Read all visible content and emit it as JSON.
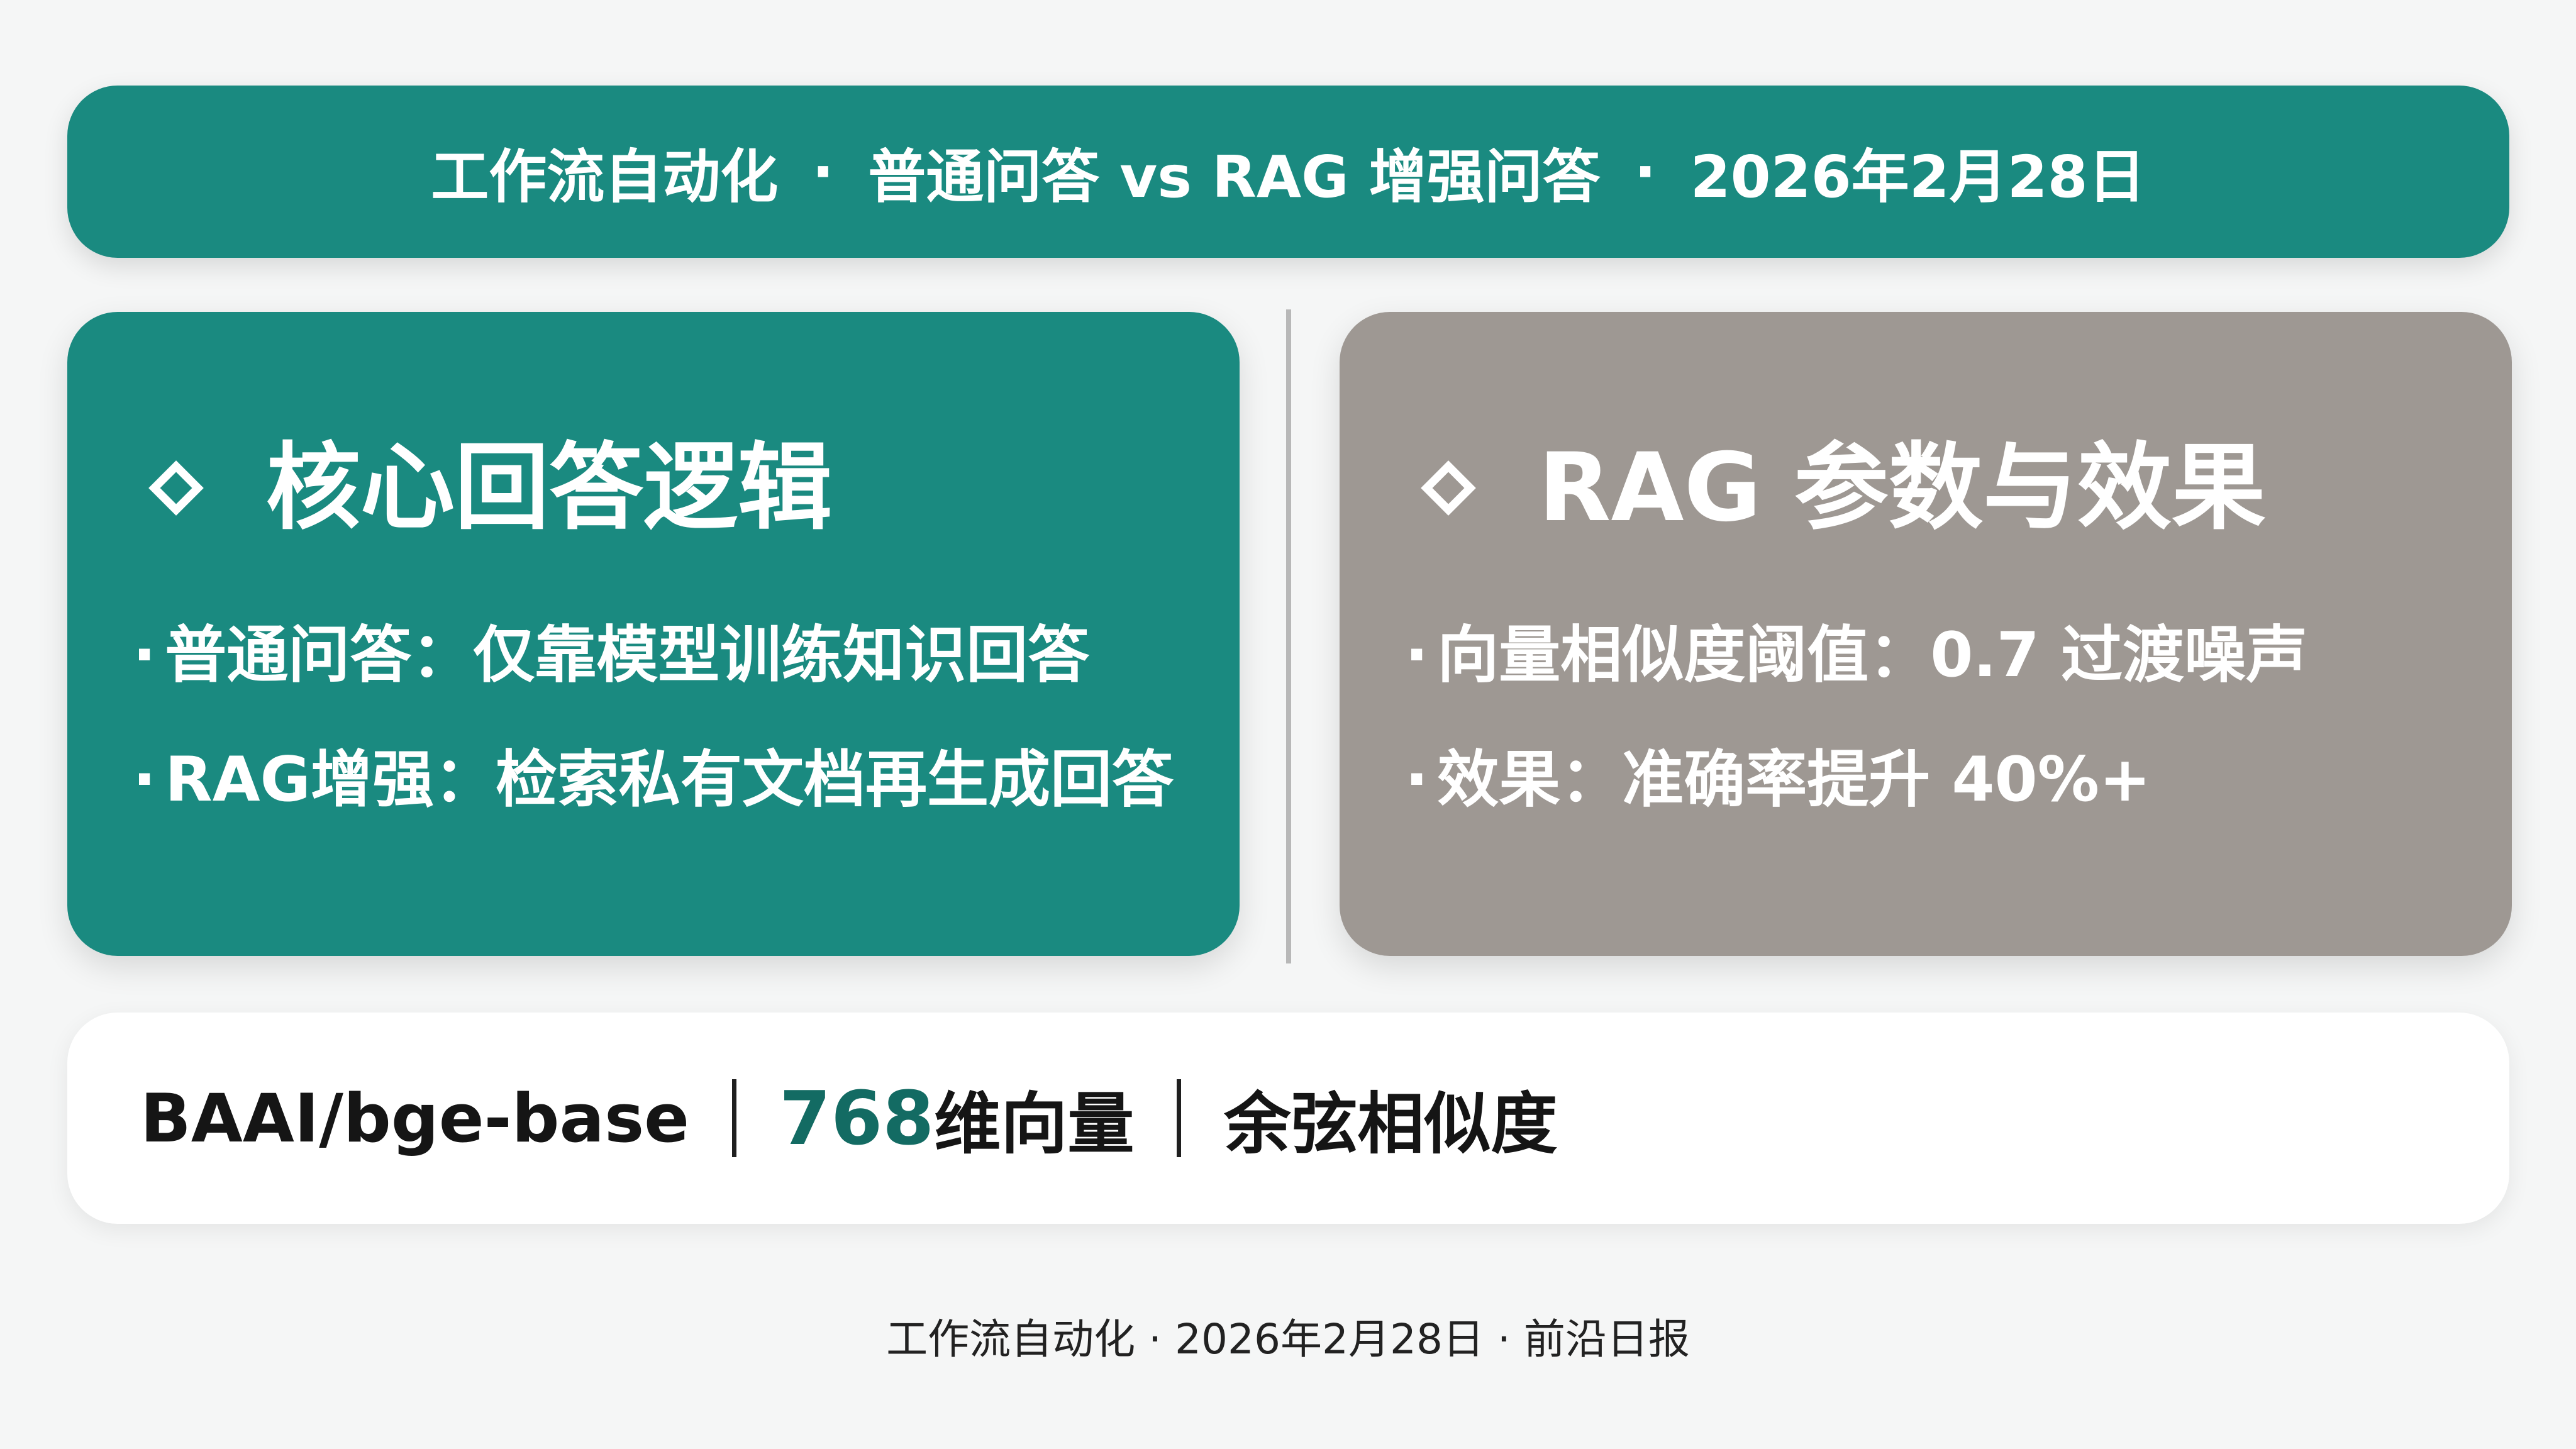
{
  "header": {
    "part1": "工作流自动化",
    "sep": "·",
    "part2": "普通问答 vs RAG 增强问答",
    "part3": "2026年2月28日"
  },
  "cards": {
    "left": {
      "title": "核心回答逻辑",
      "bullets": [
        "普通问答：仅靠模型训练知识回答",
        "RAG增强：检索私有文档再生成回答"
      ]
    },
    "right": {
      "title": "RAG 参数与效果",
      "bullets": [
        "向量相似度阈值：0.7 过渡噪声",
        "效果：准确率提升 40%+"
      ]
    },
    "bullet_dot": "·"
  },
  "specs": {
    "model": "BAAI/bge-base",
    "dim_number": "768",
    "dim_label": "维向量",
    "metric": "余弦相似度"
  },
  "footer": {
    "text": "工作流自动化 · 2026年2月28日 · 前沿日报"
  },
  "colors": {
    "teal": "#1a8a80",
    "gray": "#9e9893",
    "accent_text": "#136b63"
  }
}
